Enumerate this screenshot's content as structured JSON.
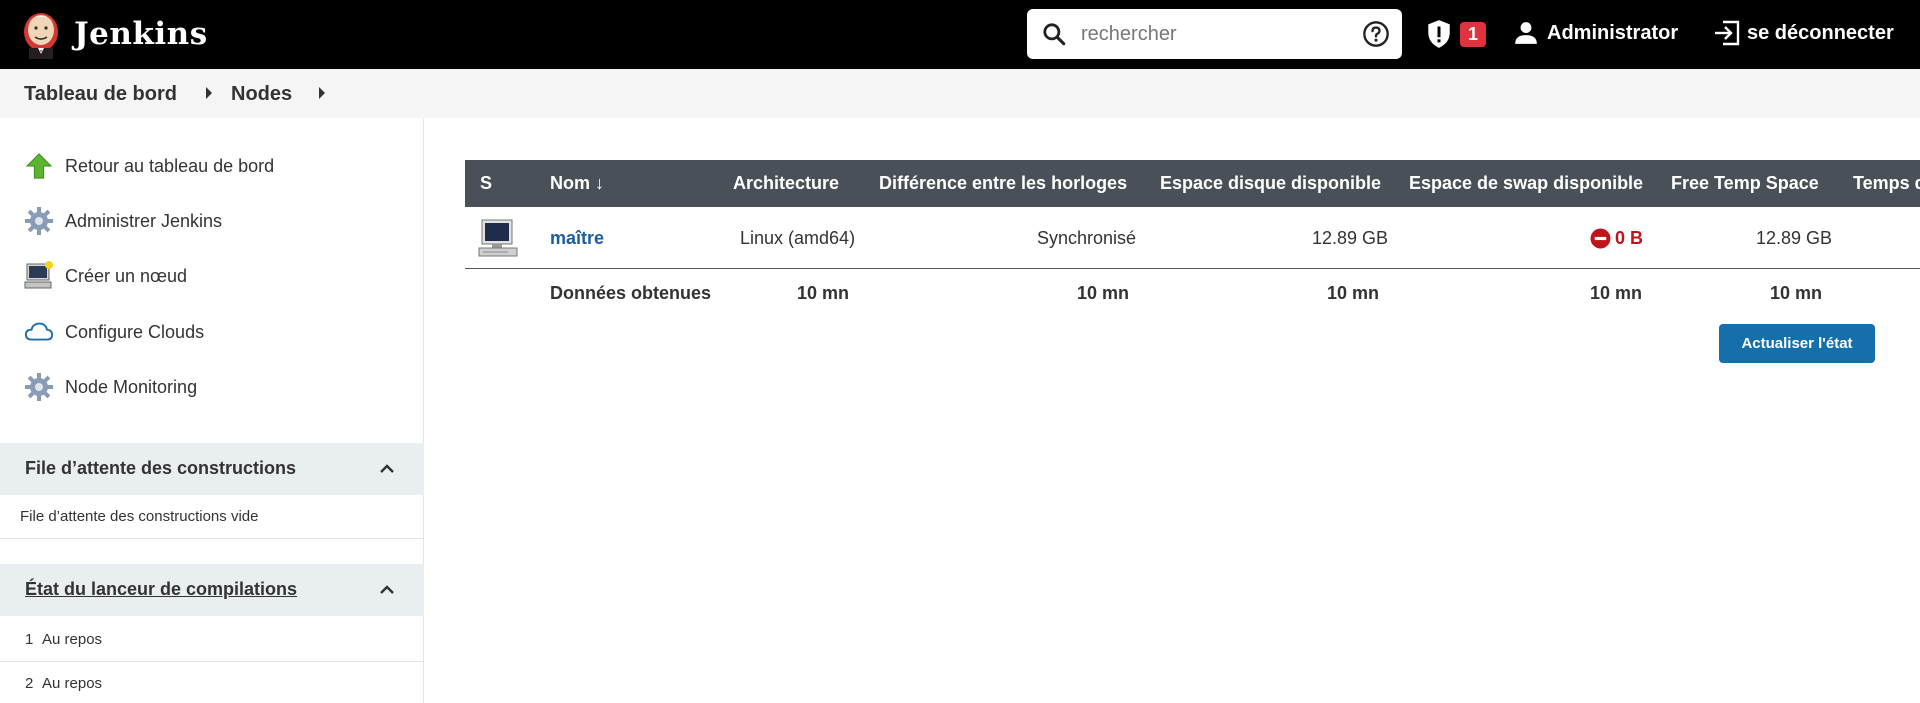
{
  "header": {
    "app_title": "Jenkins",
    "search_placeholder": "rechercher",
    "notification_count": "1",
    "user_name": "Administrator",
    "logout_label": "se déconnecter"
  },
  "breadcrumb": [
    "Tableau de bord",
    "Nodes"
  ],
  "sidebar": {
    "tasks": [
      {
        "label": "Retour au tableau de bord",
        "icon": "up-arrow-icon"
      },
      {
        "label": "Administrer Jenkins",
        "icon": "gear-icon"
      },
      {
        "label": "Créer un nœud",
        "icon": "computer-icon"
      },
      {
        "label": "Configure Clouds",
        "icon": "cloud-icon"
      },
      {
        "label": "Node Monitoring",
        "icon": "gear-icon"
      }
    ],
    "build_queue": {
      "title": "File d’attente des constructions",
      "empty_text": "File d’attente des constructions vide"
    },
    "executors": {
      "title": "État du lanceur de compilations",
      "items": [
        {
          "num": "1",
          "status": "Au repos"
        },
        {
          "num": "2",
          "status": "Au repos"
        }
      ]
    }
  },
  "table": {
    "columns": [
      "S",
      "Nom ↓",
      "Architecture",
      "Différence entre les horloges",
      "Espace disque disponible",
      "Espace de swap disponible",
      "Free Temp Space",
      "Temps d"
    ],
    "rows": [
      {
        "name": "maître",
        "architecture": "Linux (amd64)",
        "clock_diff": "Synchronisé",
        "disk_space": "12.89 GB",
        "swap_space": "0 B",
        "temp_space": "12.89 GB"
      }
    ],
    "footer": {
      "label": "Données obtenues",
      "architecture": "10 mn",
      "clock_diff": "10 mn",
      "disk_space": "10 mn",
      "swap_space": "10 mn",
      "temp_space": "10 mn"
    }
  },
  "refresh_button": "Actualiser l'état",
  "colors": {
    "header_bg": "#000000",
    "table_header_bg": "#4a5058",
    "link": "#1a5e9e",
    "error": "#c0141c",
    "button": "#146fab",
    "badge": "#e0333f"
  }
}
